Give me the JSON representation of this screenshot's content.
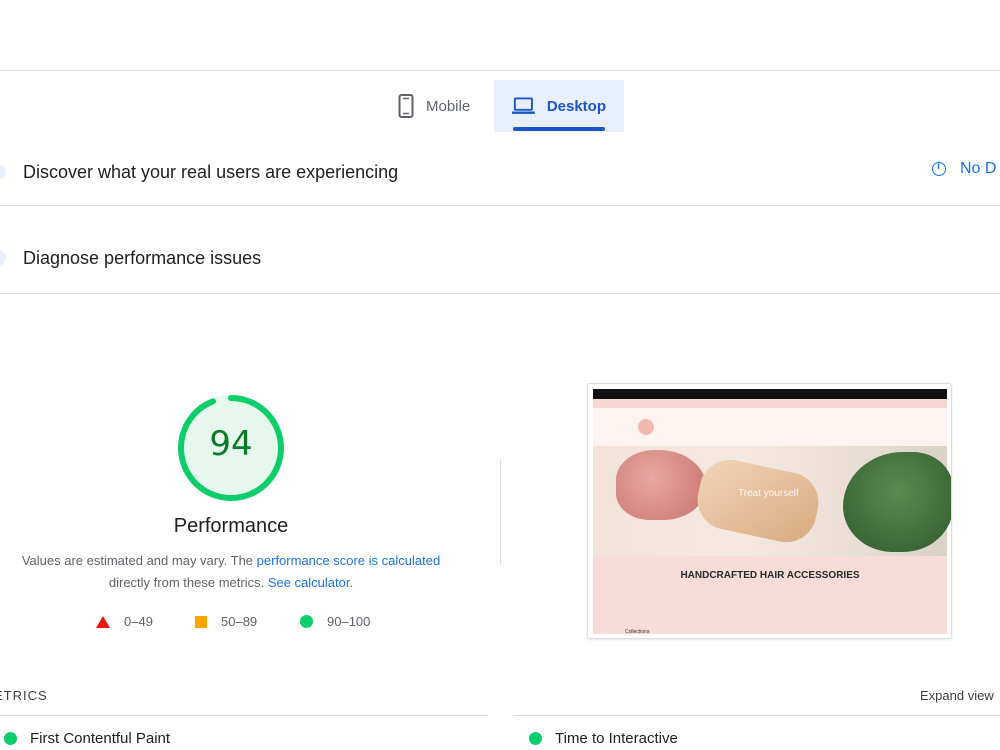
{
  "tabs": {
    "mobile": {
      "label": "Mobile",
      "icon": "phone-icon"
    },
    "desktop": {
      "label": "Desktop",
      "icon": "laptop-icon",
      "selected": true
    }
  },
  "discover": {
    "title": "Discover what your real users are experiencing",
    "status": "No D"
  },
  "diagnose": {
    "title": "Diagnose performance issues"
  },
  "score": {
    "value": 94,
    "value_text": "94",
    "label": "Performance",
    "desc_prefix": "Values are estimated and may vary. The ",
    "desc_link1": "performance score is calculated",
    "desc_middle": " directly from these metrics. ",
    "desc_link2": "See calculator",
    "desc_suffix": "."
  },
  "legend": {
    "poor": "0–49",
    "average": "50–89",
    "good": "90–100"
  },
  "thumbnail": {
    "hero_text": "Treat yourself",
    "heading": "HANDCRAFTED HAIR ACCESSORIES",
    "collections": "Collections"
  },
  "metrics": {
    "label": "ETRICS",
    "expand": "Expand view",
    "items": [
      {
        "name": "First Contentful Paint"
      },
      {
        "name": "Time to Interactive"
      }
    ]
  },
  "colors": {
    "accent": "#1a73e8",
    "tab_selected_bg": "#e8f0fe",
    "good": "#0cce6b",
    "average": "#ffa400",
    "poor": "#e8160b",
    "score_text": "#0c7a2c"
  }
}
